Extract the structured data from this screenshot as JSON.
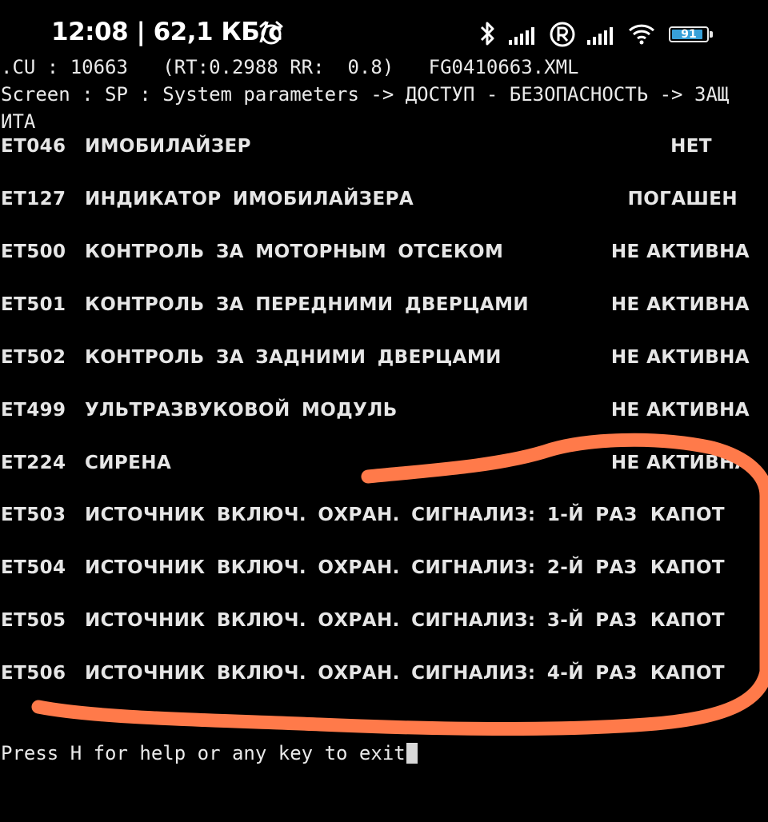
{
  "status_bar": {
    "time": "12:08 | 62,1 КБ/с",
    "battery": "91",
    "battery_level": 0.91,
    "icons": [
      "alarm-icon",
      "bluetooth-icon",
      "signal-icon",
      "registered-icon",
      "signal-icon",
      "wifi-icon",
      "battery-icon"
    ]
  },
  "header": {
    "line1": ".CU : 10663   (RT:0.2988 RR:  0.8)   FG0410663.XML",
    "line2": "Screen : SP : System parameters -> ДОСТУП - БЕЗОПАСНОСТЬ -> ЗАЩ",
    "line3": "ИТА"
  },
  "parameters": [
    {
      "code": "ET046",
      "label": "ИМОБИЛАЙЗЕР",
      "value": "НЕТ"
    },
    {
      "code": "ET127",
      "label": "ИНДИКАТОР ИМОБИЛАЙЗЕРА",
      "value": "ПОГАШЕН"
    },
    {
      "code": "ET500",
      "label": "КОНТРОЛЬ ЗА МОТОРНЫМ ОТСЕКОМ",
      "value": "НЕ АКТИВНА"
    },
    {
      "code": "ET501",
      "label": "КОНТРОЛЬ ЗА ПЕРЕДНИМИ ДВЕРЦАМИ",
      "value": "НЕ АКТИВНА"
    },
    {
      "code": "ET502",
      "label": "КОНТРОЛЬ ЗА ЗАДНИМИ ДВЕРЦАМИ",
      "value": "НЕ АКТИВНА"
    },
    {
      "code": "ET499",
      "label": "УЛЬТРАЗВУКОВОЙ МОДУЛЬ",
      "value": "НЕ АКТИВНА"
    },
    {
      "code": "ET224",
      "label": "СИРЕНА",
      "value": "НЕ АКТИВНА"
    },
    {
      "code": "ET503",
      "label": "ИСТОЧНИК ВКЛЮЧ. ОХРАН. СИГНАЛИЗ: 1-Й РАЗ",
      "value": "КАПОТ"
    },
    {
      "code": "ET504",
      "label": "ИСТОЧНИК ВКЛЮЧ. ОХРАН. СИГНАЛИЗ: 2-Й РАЗ",
      "value": "КАПОТ"
    },
    {
      "code": "ET505",
      "label": "ИСТОЧНИК ВКЛЮЧ. ОХРАН. СИГНАЛИЗ: 3-Й РАЗ",
      "value": "КАПОТ"
    },
    {
      "code": "ET506",
      "label": "ИСТОЧНИК ВКЛЮЧ. ОХРАН. СИГНАЛИЗ: 4-Й РАЗ",
      "value": "КАПОТ"
    }
  ],
  "footer": {
    "prompt": "Press H for help or any key to exit"
  },
  "colors": {
    "background": "#000000",
    "text": "#e6e6e6",
    "annotation": "#ff7a4a",
    "battery_fill": "#38a0d8"
  }
}
